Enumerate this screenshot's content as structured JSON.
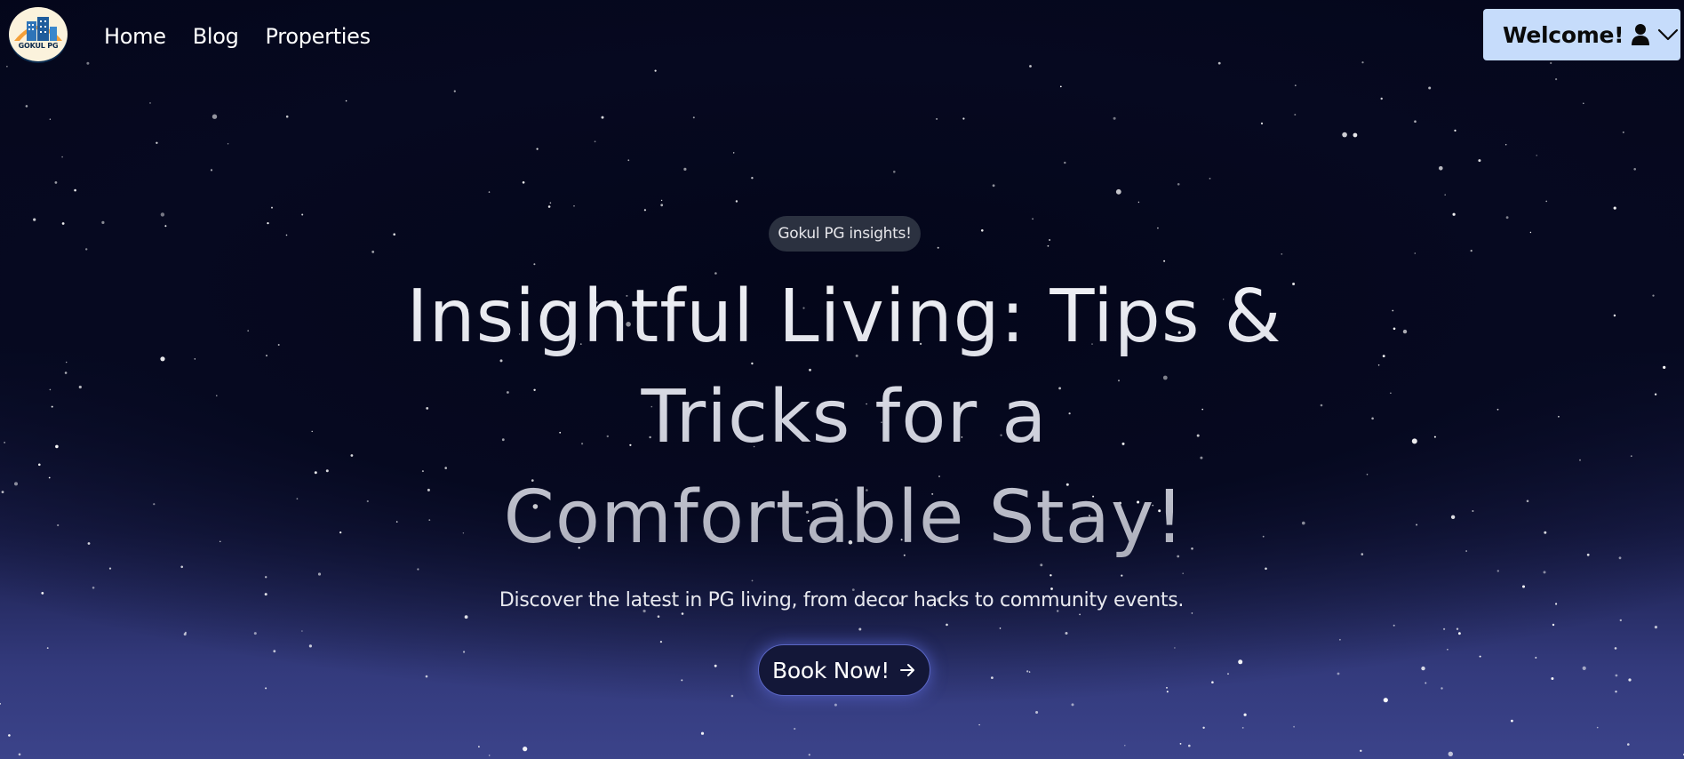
{
  "nav": {
    "logo_text": "GOKUL PG",
    "links": [
      "Home",
      "Blog",
      "Properties"
    ],
    "welcome_label": "Welcome!"
  },
  "hero": {
    "badge": "Gokul PG insights!",
    "headline_lines": [
      "Insightful Living: Tips &",
      "Tricks for a",
      "Comfortable Stay!"
    ],
    "subtext": "Discover the latest in PG living, from decor hacks to community events.",
    "cta_label": "Book Now!"
  },
  "icons": {
    "user": "user-icon",
    "chevron": "chevron-down-icon",
    "arrow": "arrow-right-icon"
  },
  "colors": {
    "background_top": "#060920",
    "background_bottom": "#3b438a",
    "welcome_button": "#c6dcfb",
    "badge": "#2b3140",
    "cta_border": "#5a66c4"
  }
}
